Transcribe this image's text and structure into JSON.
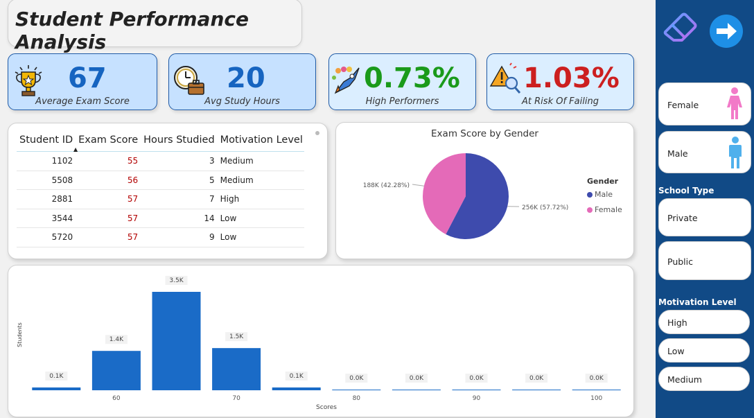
{
  "title": "Student Performance Analysis",
  "kpis": [
    {
      "value": "67",
      "label": "Average Exam Score",
      "color": "#1664c0",
      "icon": "trophy-icon"
    },
    {
      "value": "20",
      "label": "Avg Study Hours",
      "color": "#1664c0",
      "icon": "clock-briefcase-icon"
    },
    {
      "value": "0.73%",
      "label": "High Performers",
      "color": "#1a9a1a",
      "icon": "rocket-icon"
    },
    {
      "value": "1.03%",
      "label": "At Risk Of Failing",
      "color": "#cc1f1f",
      "icon": "warning-search-icon"
    }
  ],
  "table": {
    "columns": [
      "Student ID",
      "Exam Score",
      "Hours Studied",
      "Motivation Level"
    ],
    "rows": [
      [
        "1102",
        "55",
        "3",
        "Medium"
      ],
      [
        "5508",
        "56",
        "5",
        "Medium"
      ],
      [
        "2881",
        "57",
        "7",
        "High"
      ],
      [
        "3544",
        "57",
        "14",
        "Low"
      ],
      [
        "5720",
        "57",
        "9",
        "Low"
      ]
    ]
  },
  "pie": {
    "title": "Exam Score by Gender",
    "legend_title": "Gender",
    "legend": [
      "Male",
      "Female"
    ],
    "colors": [
      "#3e4bad",
      "#e46ab8"
    ]
  },
  "sidebar": {
    "genders": [
      "Female",
      "Male"
    ],
    "school_type_label": "School Type",
    "school_types": [
      "Private",
      "Public"
    ],
    "motivation_label": "Motivation Level",
    "motivation_levels": [
      "High",
      "Low",
      "Medium"
    ]
  },
  "chart_data": [
    {
      "type": "pie",
      "title": "Exam Score by Gender",
      "legend_title": "Gender",
      "slices": [
        {
          "name": "Male",
          "value": 256,
          "label": "256K (57.72%)",
          "color": "#3e4bad"
        },
        {
          "name": "Female",
          "value": 188,
          "label": "188K (42.28%)",
          "color": "#e46ab8"
        }
      ]
    },
    {
      "type": "bar",
      "xlabel": "Scores",
      "ylabel": "Students",
      "x": [
        55,
        60,
        65,
        70,
        75,
        80,
        85,
        90,
        95,
        100
      ],
      "values": [
        0.1,
        1.4,
        3.5,
        1.5,
        0.1,
        0.0,
        0.0,
        0.0,
        0.0,
        0.0
      ],
      "data_labels": [
        "0.1K",
        "1.4K",
        "3.5K",
        "1.5K",
        "0.1K",
        "0.0K",
        "0.0K",
        "0.0K",
        "0.0K",
        "0.0K"
      ],
      "tick_labels": [
        "60",
        "70",
        "80",
        "90",
        "100"
      ],
      "tick_x": [
        60,
        70,
        80,
        90,
        100
      ],
      "ylim": [
        0,
        3.5
      ],
      "color": "#1a6bc7"
    }
  ]
}
